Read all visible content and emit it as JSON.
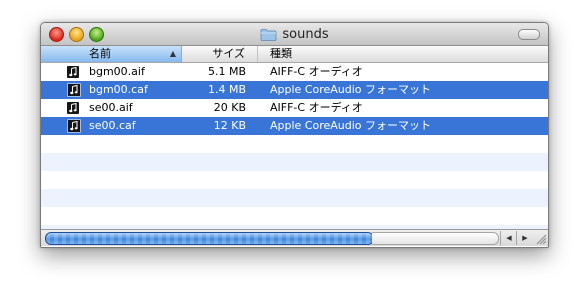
{
  "window": {
    "title": "sounds",
    "icons": {
      "folder": "folder-icon",
      "file": "audio-file-icon"
    }
  },
  "columns": {
    "name": "名前",
    "size": "サイズ",
    "kind": "種類"
  },
  "files": [
    {
      "name": "bgm00.aif",
      "size": "5.1 MB",
      "kind": "AIFF-C オーディオ",
      "selected": false
    },
    {
      "name": "bgm00.caf",
      "size": "1.4 MB",
      "kind": "Apple CoreAudio フォーマット",
      "selected": true
    },
    {
      "name": "se00.aif",
      "size": "20 KB",
      "kind": "AIFF-C オーディオ",
      "selected": false
    },
    {
      "name": "se00.caf",
      "size": "12 KB",
      "kind": "Apple CoreAudio フォーマット",
      "selected": true
    }
  ],
  "colors": {
    "selection": "#3875d7",
    "alt_row": "#edf3fe",
    "header_sorted": "#86b9ee"
  }
}
